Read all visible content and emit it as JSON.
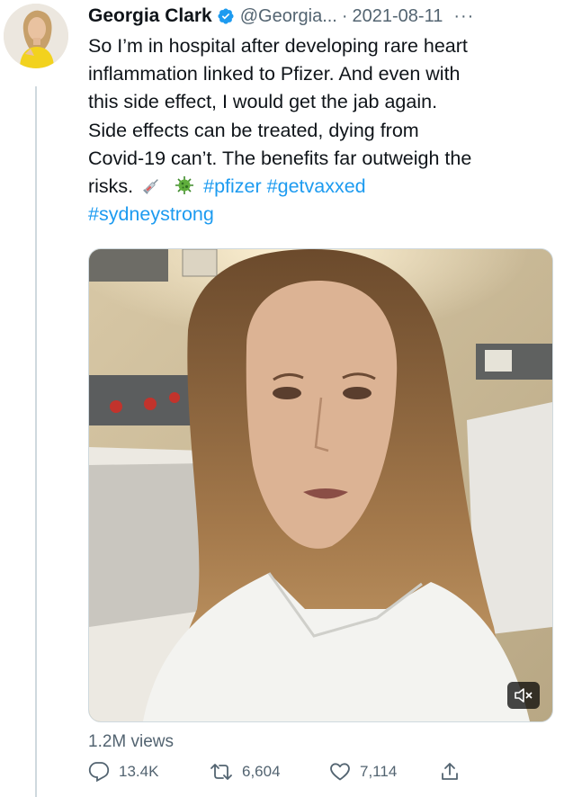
{
  "tweet": {
    "author_name": "Georgia Clark",
    "handle": "@Georgia...",
    "separator": "·",
    "date": "2021-08-11",
    "more_label": "···",
    "text_lines": [
      "So I’m in hospital after developing rare heart",
      "inflammation linked to Pfizer. And even with",
      "this side effect, I would get the jab again.",
      "Side effects can be treated, dying from",
      "Covid-19 can’t. The benefits far outweigh the"
    ],
    "last_line_text": "risks.",
    "hashtags": [
      "#pfizer",
      "#getvaxxed",
      "#sydneystrong"
    ],
    "views": "1.2M views",
    "replies": "13.4K",
    "retweets": "6,604",
    "likes": "7,114"
  },
  "icons": {
    "verified": "verified-badge-icon",
    "syringe": "syringe-icon",
    "virus": "microbe-icon",
    "mute": "speaker-muted-icon",
    "reply": "reply-icon",
    "retweet": "retweet-icon",
    "like": "heart-icon",
    "share": "share-icon"
  },
  "colors": {
    "link": "#1d9bf0",
    "secondary_text": "#536471",
    "primary_text": "#0f1419"
  }
}
